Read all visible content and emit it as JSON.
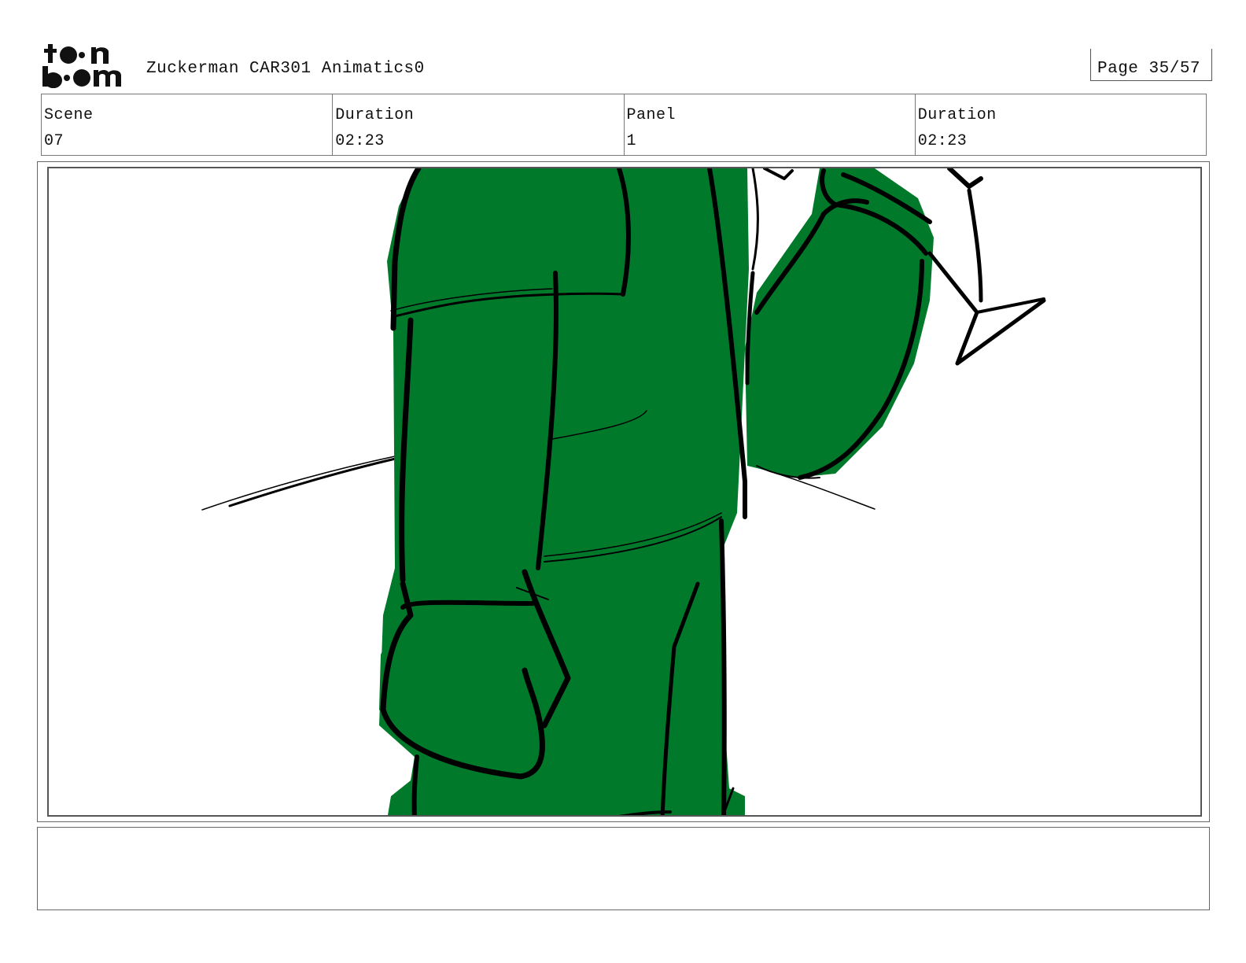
{
  "header": {
    "logo_text": "toonboom",
    "project_title": "Zuckerman CAR301 Animatics0",
    "page_label": "Page 35/57"
  },
  "info": {
    "scene_label": "Scene",
    "scene_value": "07",
    "scene_duration_label": "Duration",
    "scene_duration_value": "02:23",
    "panel_label": "Panel",
    "panel_value": "1",
    "panel_duration_label": "Duration",
    "panel_duration_value": "02:23"
  },
  "panel": {
    "drawing_colors": {
      "fill": "#007a2a",
      "stroke": "#000000"
    }
  },
  "notes": {
    "text": ""
  }
}
